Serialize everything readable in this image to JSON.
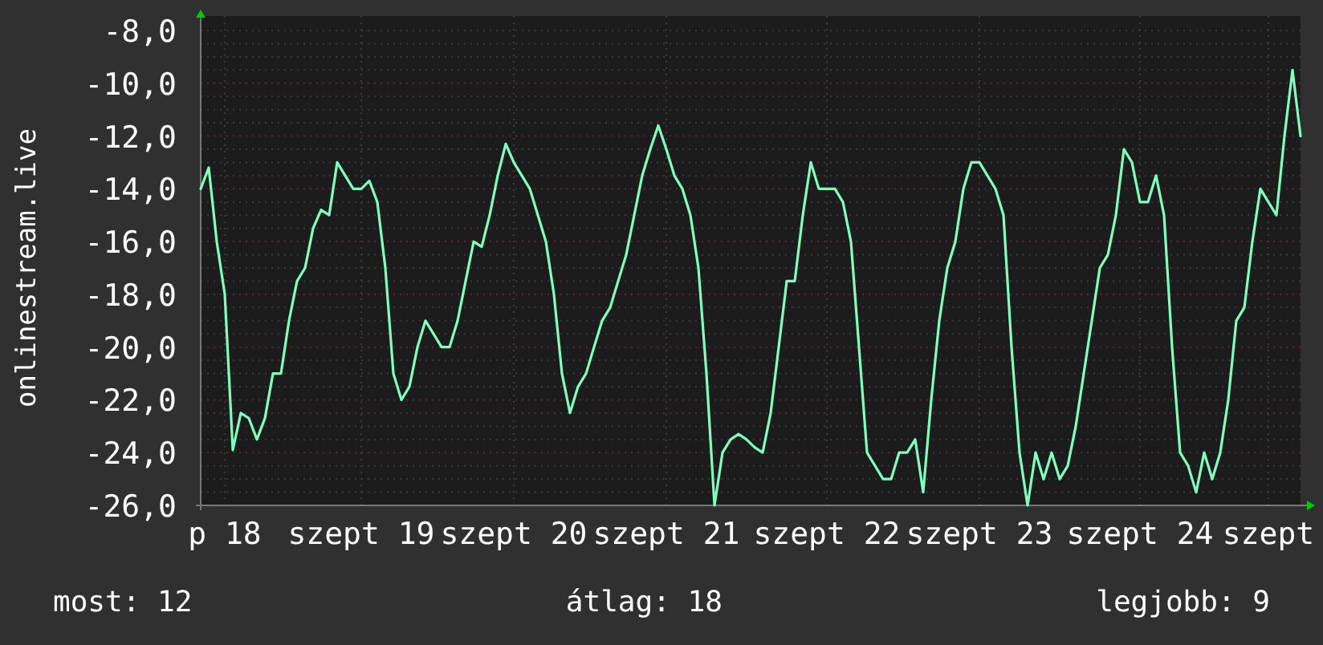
{
  "chart": {
    "chart_data": {
      "type": "line",
      "ylabel": "onlinestream.live",
      "ylim": [
        -26,
        -8
      ],
      "grid": true,
      "categories": [
        null,
        null,
        null,
        "p 18",
        null,
        null,
        null,
        null,
        null,
        null,
        null,
        null,
        null,
        null,
        null,
        null,
        null,
        null,
        null,
        null,
        "szept 19",
        null,
        null,
        null,
        null,
        null,
        null,
        null,
        null,
        null,
        null,
        null,
        null,
        null,
        null,
        null,
        null,
        null,
        null,
        "szept 20",
        null,
        null,
        null,
        null,
        null,
        null,
        null,
        null,
        null,
        null,
        null,
        null,
        null,
        null,
        null,
        null,
        null,
        null,
        "szept 21",
        null,
        null,
        null,
        null,
        null,
        null,
        null,
        null,
        null,
        null,
        null,
        null,
        null,
        null,
        null,
        null,
        null,
        null,
        null,
        "szept 22",
        null,
        null,
        null,
        null,
        null,
        null,
        null,
        null,
        null,
        null,
        null,
        null,
        null,
        null,
        null,
        null,
        null,
        null,
        "szept 23",
        null,
        null,
        null,
        null,
        null,
        null,
        null,
        null,
        null,
        null,
        null,
        null,
        null,
        null,
        null,
        null,
        null,
        null,
        null,
        "szept 24",
        null,
        null,
        null,
        null,
        null,
        null,
        null,
        null,
        null,
        null,
        null,
        null,
        null,
        null,
        null,
        "szept",
        null,
        null,
        null,
        null
      ],
      "yticks": [
        {
          "value": -8,
          "label": "-8,0"
        },
        {
          "value": -10,
          "label": "-10,0"
        },
        {
          "value": -12,
          "label": "-12,0"
        },
        {
          "value": -14,
          "label": "-14,0"
        },
        {
          "value": -16,
          "label": "-16,0"
        },
        {
          "value": -18,
          "label": "-18,0"
        },
        {
          "value": -20,
          "label": "-20,0"
        },
        {
          "value": -22,
          "label": "-22,0"
        },
        {
          "value": -24,
          "label": "-24,0"
        },
        {
          "value": -26,
          "label": "-26,0"
        }
      ],
      "series": [
        {
          "color": "#80ffc0",
          "values": [
            -14,
            -13.2,
            -16,
            -18,
            -23.9,
            -22.5,
            -22.7,
            -23.5,
            -22.7,
            -21,
            -21,
            -19,
            -17.5,
            -17,
            -15.5,
            -14.8,
            -15,
            -13,
            -13.5,
            -14,
            -14,
            -13.7,
            -14.5,
            -17,
            -21,
            -22,
            -21.5,
            -20,
            -19,
            -19.5,
            -20,
            -20,
            -19,
            -17.5,
            -16,
            -16.2,
            -15,
            -13.5,
            -12.3,
            -13,
            -13.5,
            -14,
            -15,
            -16,
            -18,
            -21,
            -22.5,
            -21.5,
            -21,
            -20,
            -19,
            -18.5,
            -17.5,
            -16.5,
            -15,
            -13.5,
            -12.5,
            -11.6,
            -12.5,
            -13.5,
            -14,
            -15,
            -17,
            -21,
            -26,
            -24,
            -23.5,
            -23.3,
            -23.5,
            -23.8,
            -24,
            -22.5,
            -20,
            -17.5,
            -17.5,
            -15,
            -13,
            -14,
            -14,
            -14,
            -14.5,
            -16,
            -20,
            -24,
            -24.5,
            -25,
            -25,
            -24,
            -24,
            -23.5,
            -25.5,
            -22,
            -19,
            -17,
            -16,
            -14,
            -13,
            -13,
            -13.5,
            -14,
            -15,
            -20,
            -24,
            -26,
            -24,
            -25,
            -24,
            -25,
            -24.5,
            -23,
            -21,
            -19,
            -17,
            -16.5,
            -15,
            -12.5,
            -13,
            -14.5,
            -14.5,
            -13.5,
            -15,
            -20,
            -24,
            -24.5,
            -25.5,
            -24,
            -25,
            -24,
            -22,
            -19,
            -18.5,
            -16,
            -14,
            -14.5,
            -15,
            -12,
            -9.5,
            -12
          ]
        }
      ]
    }
  },
  "legend": [
    {
      "label": "most: 12"
    },
    {
      "label": "átlag: 18"
    },
    {
      "label": "legjobb: 9"
    }
  ]
}
